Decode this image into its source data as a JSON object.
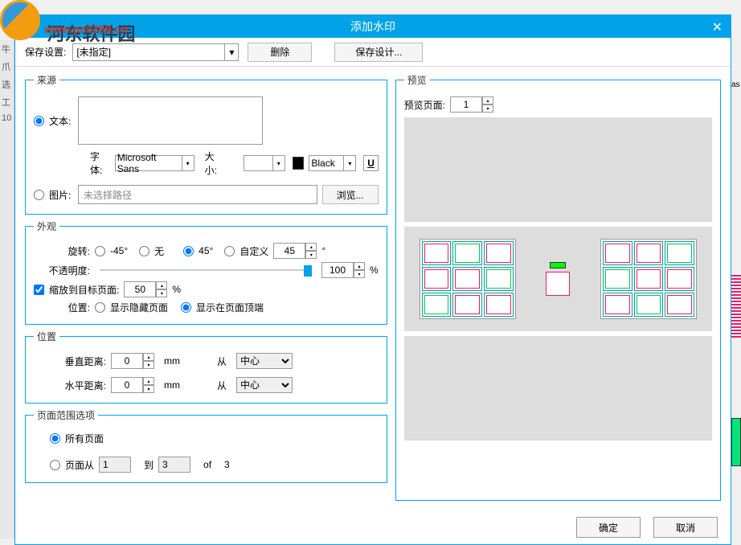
{
  "logo": {
    "text": "河东软件园",
    "url": "www.pc0359.cn"
  },
  "leftStrip": {
    "a": "牛",
    "b": "爪",
    "c": "选",
    "d": "工",
    "e": "10"
  },
  "dialog": {
    "title": "添加水印",
    "close": "✕"
  },
  "toolbar": {
    "saveSettingsLabel": "保存设置:",
    "saveSettingsValue": "[未指定]",
    "deleteBtn": "删除",
    "saveDesignBtn": "保存设计..."
  },
  "source": {
    "legend": "来源",
    "textRadio": "文本:",
    "fontLabel": "字体:",
    "fontValue": "Microsoft Sans",
    "sizeLabel": "大小:",
    "colorValue": "Black",
    "uBtn": "U",
    "imageRadio": "图片:",
    "pathPlaceholder": "未选择路径",
    "browseBtn": "浏览..."
  },
  "appearance": {
    "legend": "外观",
    "rotateLabel": "旋转:",
    "rotNeg45": "-45°",
    "rotNone": "无",
    "rot45": "45°",
    "rotCustom": "自定义",
    "rotValue": "45",
    "degree": "°",
    "opacityLabel": "不透明度:",
    "opacityValue": "100",
    "percent": "%",
    "scaleCheck": "缩放到目标页面:",
    "scaleValue": "50",
    "posLabel": "位置:",
    "posHidden": "显示隐藏页面",
    "posTop": "显示在页面顶端"
  },
  "position": {
    "legend": "位置",
    "vertLabel": "垂直距离:",
    "vertValue": "0",
    "unit": "mm",
    "fromLabel": "从",
    "centerValue": "中心",
    "horizLabel": "水平距离:",
    "horizValue": "0"
  },
  "pageRange": {
    "legend": "页面范围选项",
    "allPages": "所有页面",
    "pagesFrom": "页面从",
    "fromValue": "1",
    "toLabel": "到",
    "toValue": "3",
    "ofLabel": "of",
    "totalValue": "3"
  },
  "preview": {
    "legend": "预览",
    "pageLabel": "预览页面:",
    "pageValue": "1"
  },
  "footer": {
    "ok": "确定",
    "cancel": "取消"
  },
  "rightStrip": {
    "as": "as"
  }
}
